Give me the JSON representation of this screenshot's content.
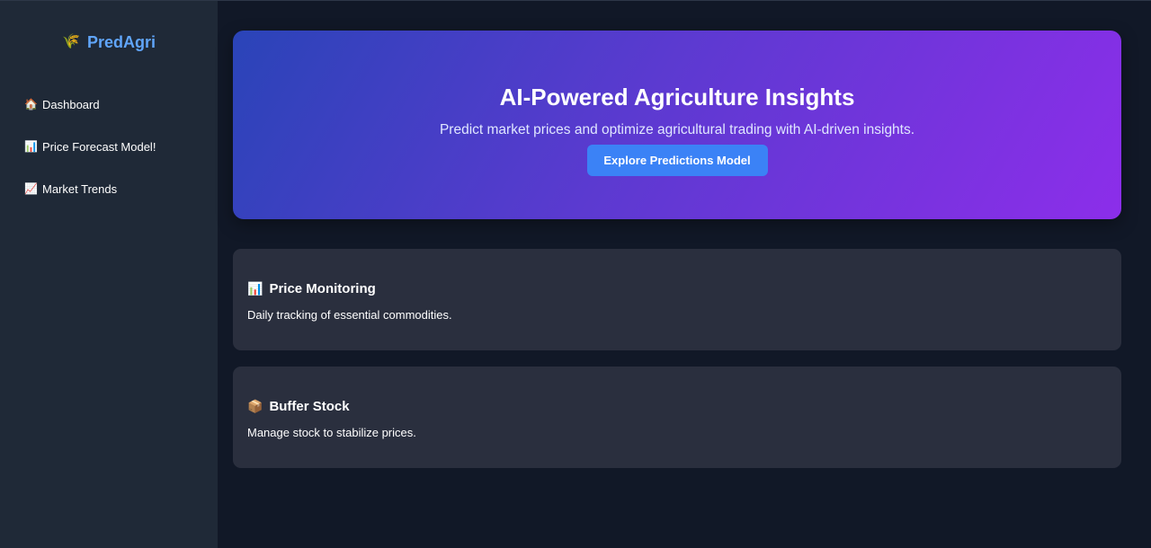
{
  "sidebar": {
    "brand": {
      "icon": "corn-icon",
      "glyph": "🌾",
      "name": "PredAgri"
    },
    "items": [
      {
        "icon": "house-icon",
        "glyph": "🏠",
        "label": "Dashboard"
      },
      {
        "icon": "bar-chart-icon",
        "glyph": "📊",
        "label": "Price Forecast Model!"
      },
      {
        "icon": "trend-up-icon",
        "glyph": "📈",
        "label": "Market Trends"
      }
    ]
  },
  "hero": {
    "title": "AI-Powered Agriculture Insights",
    "subtitle": "Predict market prices and optimize agricultural trading with AI-driven insights.",
    "cta_label": "Explore Predictions Model"
  },
  "cards": [
    {
      "icon": "bar-chart-icon",
      "glyph": "📊",
      "title": "Price Monitoring",
      "description": "Daily tracking of essential commodities."
    },
    {
      "icon": "package-icon",
      "glyph": "📦",
      "title": "Buffer Stock",
      "description": "Manage stock to stabilize prices."
    }
  ],
  "colors": {
    "page_bg": "#111827",
    "sidebar_bg": "#1f2937",
    "brand": "#60a5fa",
    "accent_button": "#3b82f6",
    "card_bg": "#2a2f3e",
    "hero_gradient_start": "#2a44b8",
    "hero_gradient_end": "#8c2eea"
  }
}
